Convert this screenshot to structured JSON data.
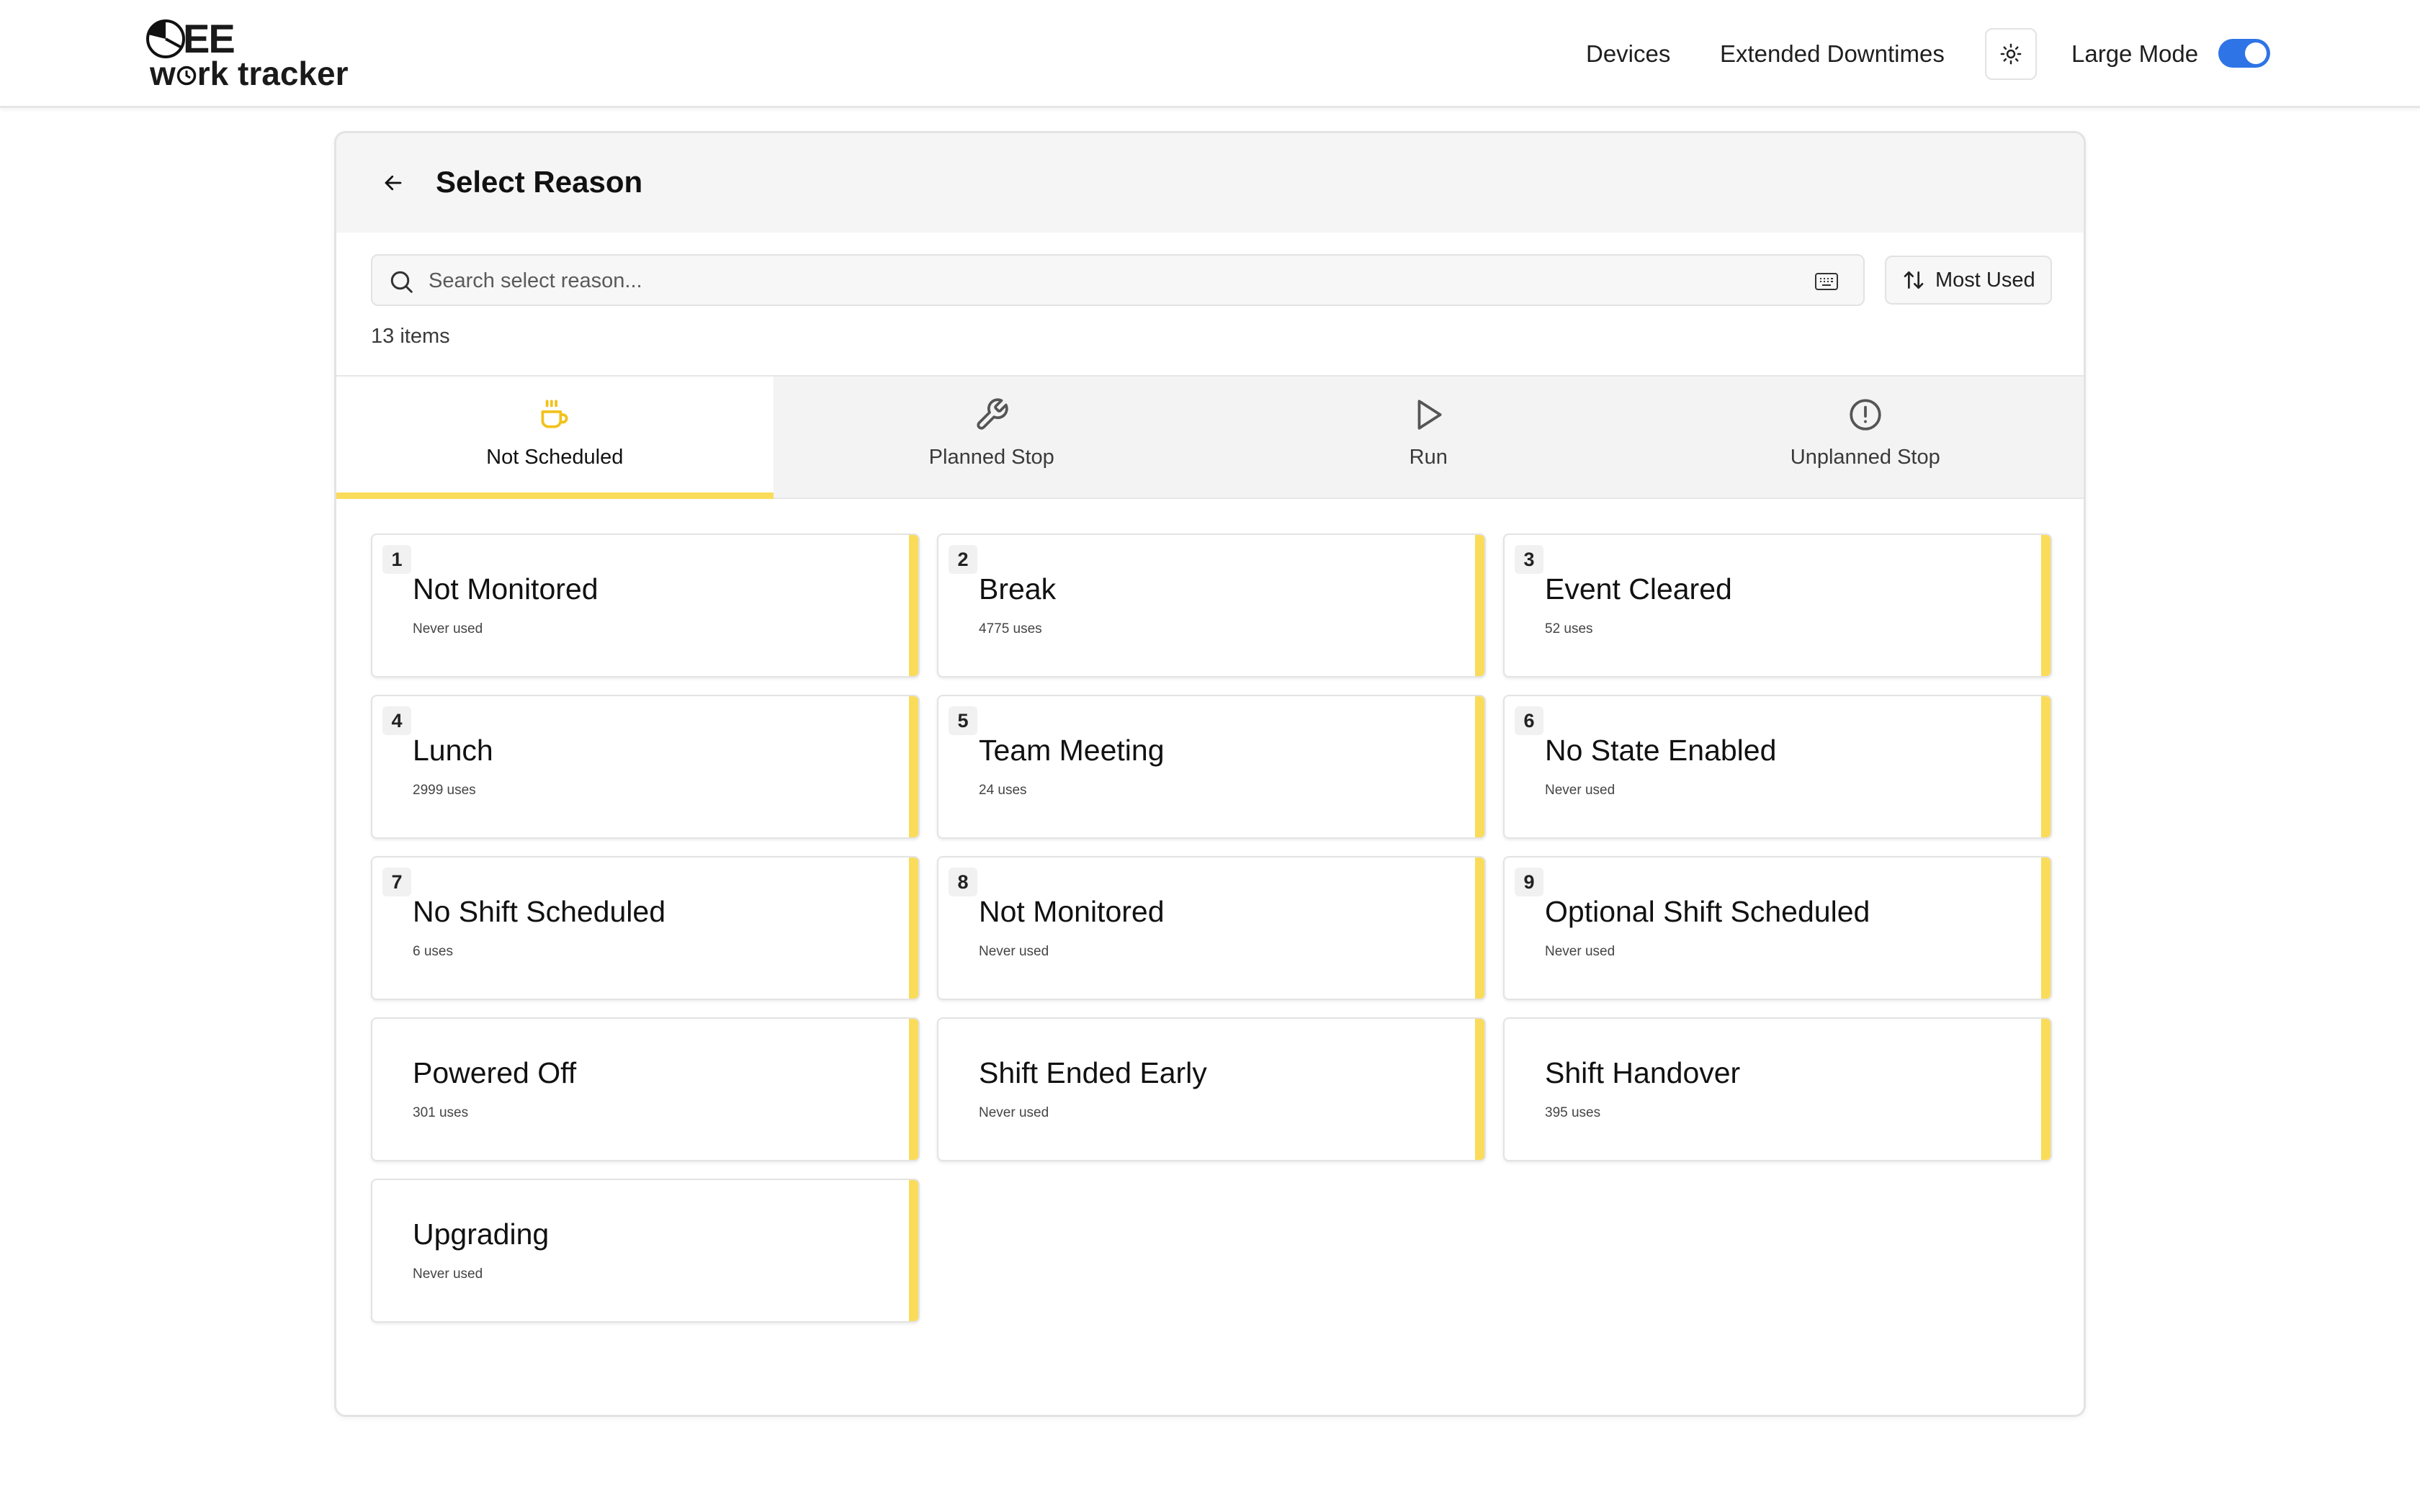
{
  "header": {
    "logo_line1": "EE",
    "logo_w": "w",
    "logo_rest": "rk tracker",
    "nav": {
      "devices": "Devices",
      "extended_downtimes": "Extended Downtimes"
    },
    "large_mode_label": "Large Mode",
    "large_mode_on": true
  },
  "panel": {
    "title": "Select Reason",
    "search_placeholder": "Search select reason...",
    "sort_label": "Most Used",
    "count_label": "13 items"
  },
  "tabs": [
    {
      "label": "Not Scheduled",
      "icon": "coffee-icon",
      "active": true
    },
    {
      "label": "Planned Stop",
      "icon": "wrench-icon",
      "active": false
    },
    {
      "label": "Run",
      "icon": "play-icon",
      "active": false
    },
    {
      "label": "Unplanned Stop",
      "icon": "alert-circle-icon",
      "active": false
    }
  ],
  "colors": {
    "accent_yellow": "#fadc5a",
    "toggle_blue": "#2f74e6"
  },
  "reasons": [
    {
      "num": "1",
      "name": "Not Monitored",
      "uses": "Never used"
    },
    {
      "num": "2",
      "name": "Break",
      "uses": "4775 uses"
    },
    {
      "num": "3",
      "name": "Event Cleared",
      "uses": "52 uses"
    },
    {
      "num": "4",
      "name": "Lunch",
      "uses": "2999 uses"
    },
    {
      "num": "5",
      "name": "Team Meeting",
      "uses": "24 uses"
    },
    {
      "num": "6",
      "name": "No State Enabled",
      "uses": "Never used"
    },
    {
      "num": "7",
      "name": "No Shift Scheduled",
      "uses": "6 uses"
    },
    {
      "num": "8",
      "name": "Not Monitored",
      "uses": "Never used"
    },
    {
      "num": "9",
      "name": "Optional Shift Scheduled",
      "uses": "Never used"
    },
    {
      "num": "",
      "name": "Powered Off",
      "uses": "301 uses"
    },
    {
      "num": "",
      "name": "Shift Ended Early",
      "uses": "Never used"
    },
    {
      "num": "",
      "name": "Shift Handover",
      "uses": "395 uses"
    },
    {
      "num": "",
      "name": "Upgrading",
      "uses": "Never used"
    }
  ]
}
